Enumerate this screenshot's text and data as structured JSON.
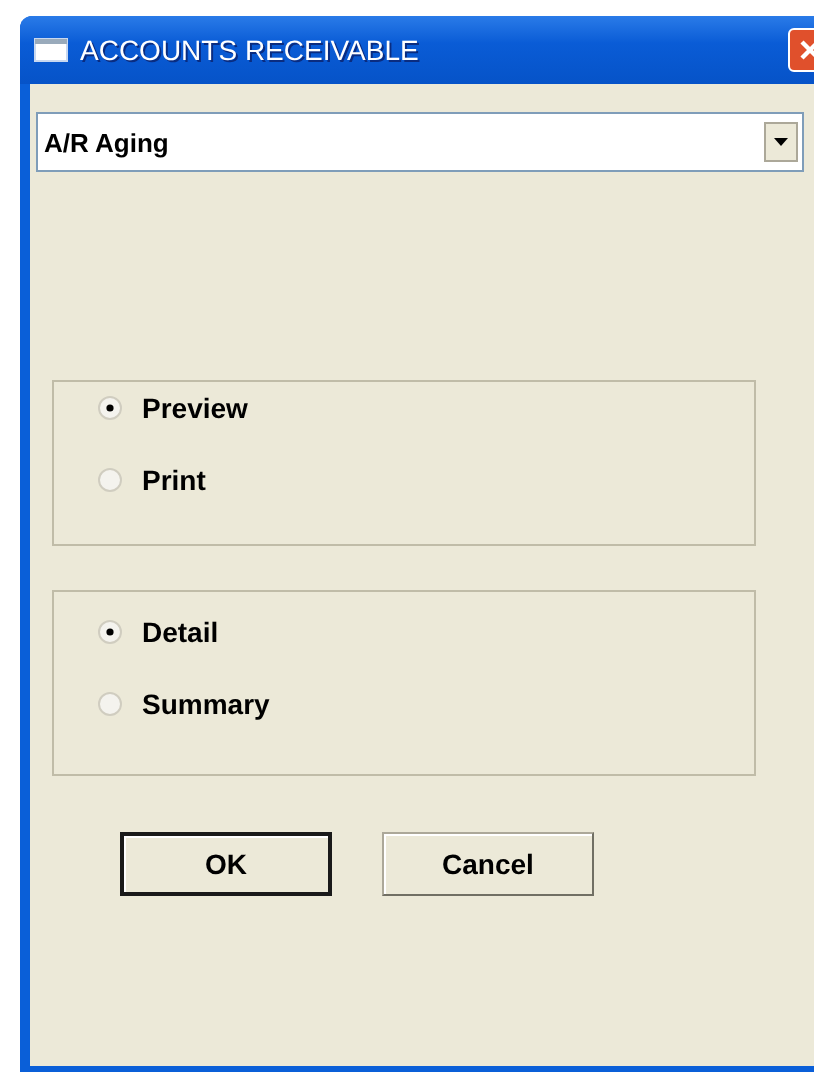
{
  "window": {
    "title": "ACCOUNTS RECEIVABLE"
  },
  "report_dropdown": {
    "value": "A/R Aging"
  },
  "option_groups": [
    {
      "options": [
        {
          "label": "Preview",
          "selected": true
        },
        {
          "label": "Print",
          "selected": false
        }
      ]
    },
    {
      "options": [
        {
          "label": "Detail",
          "selected": true
        },
        {
          "label": "Summary",
          "selected": false
        }
      ]
    }
  ],
  "buttons": [
    {
      "label": "OK",
      "default": true
    },
    {
      "label": "Cancel",
      "default": false
    }
  ]
}
